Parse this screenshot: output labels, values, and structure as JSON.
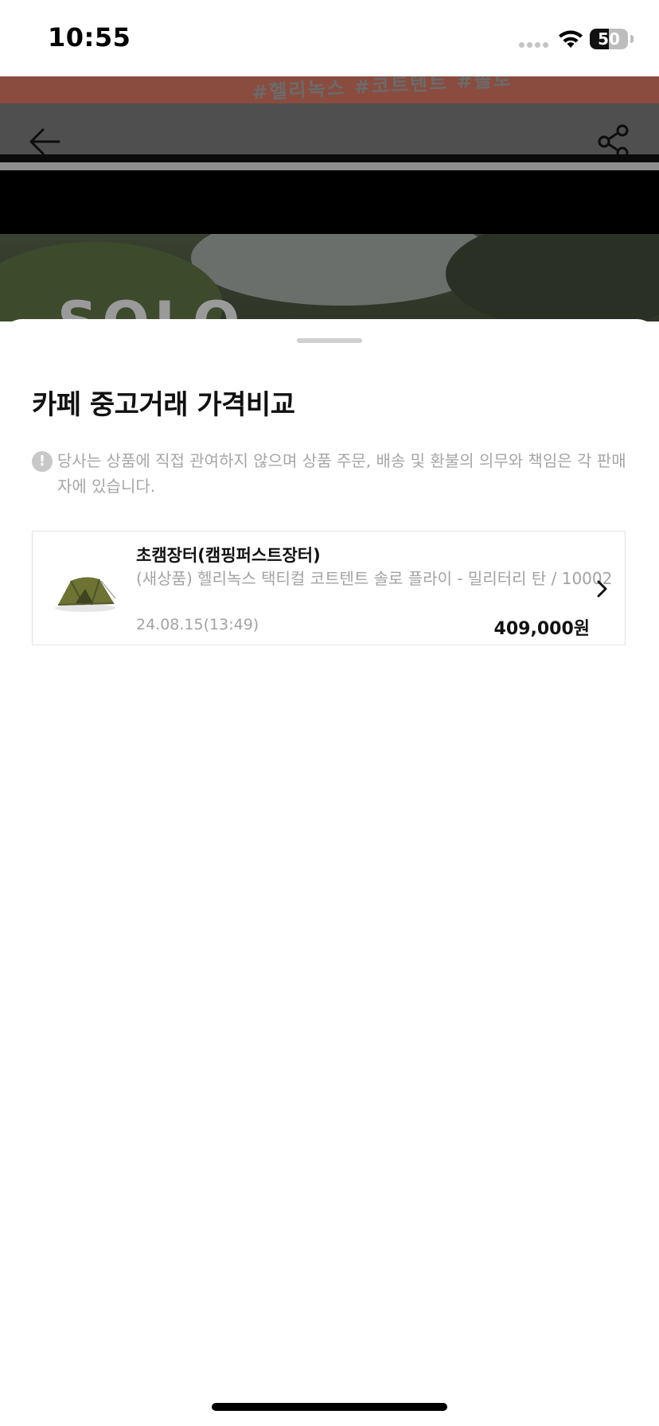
{
  "status_bar": {
    "time": "10:55",
    "battery_level": "50",
    "battery_percent": 50,
    "icons": [
      "signal-dots-icon",
      "wifi-icon",
      "battery-icon"
    ]
  },
  "background_page": {
    "banner_text": "#헬리녹스 #코트텐트 #솔로",
    "brand_text": "SOLO",
    "icons": [
      "back-arrow-icon",
      "share-icon"
    ]
  },
  "sheet": {
    "title": "카페 중고거래 가격비교",
    "notice": "당사는 상품에 직접 관여하지 않으며 상품 주문, 배송 및 환불의 의무와 책임은 각 판매자에 있습니다.",
    "notice_icon": "exclamation-icon",
    "products": [
      {
        "store": "초캠장터(캠핑퍼스트장터)",
        "title": "(새상품) 헬리녹스 택티컬 코트텐트 솔로 플라이 - 밀리터리 탄 / 10002",
        "date": "24.08.15(13:49)",
        "price": "409,000원",
        "thumb_icon": "tent-icon"
      }
    ]
  },
  "colors": {
    "sheet_bg": "#ffffff",
    "overlay_header": "#4f4f4f",
    "muted_text": "#a3a3a3",
    "card_border": "#e3e3e3"
  }
}
